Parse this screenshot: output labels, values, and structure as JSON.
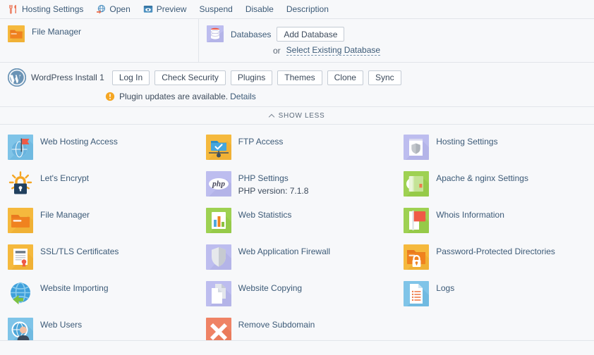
{
  "toolbar": {
    "items": [
      {
        "label": "Hosting Settings",
        "icon": "tools-icon"
      },
      {
        "label": "Open",
        "icon": "open-external-icon"
      },
      {
        "label": "Preview",
        "icon": "preview-window-icon"
      },
      {
        "label": "Suspend",
        "icon": "none"
      },
      {
        "label": "Disable",
        "icon": "none"
      },
      {
        "label": "Description",
        "icon": "none"
      }
    ]
  },
  "file_manager_row": {
    "file_manager": {
      "label": "File Manager",
      "icon": "folder-orange-icon"
    },
    "databases": {
      "label": "Databases",
      "icon": "database-icon",
      "add_button": "Add Database",
      "or_text": "or",
      "select_link": "Select Existing Database"
    }
  },
  "wordpress": {
    "icon": "wordpress-icon",
    "name": "WordPress Install 1",
    "buttons": [
      "Log In",
      "Check Security",
      "Plugins",
      "Themes",
      "Clone",
      "Sync"
    ],
    "warning_icon": "warning-icon",
    "warning_text": "Plugin updates are available.",
    "warning_link": "Details"
  },
  "show_less": {
    "label": "SHOW LESS",
    "icon": "chevron-up-icon"
  },
  "grid": {
    "items": [
      {
        "title": "Web Hosting Access",
        "sub": "",
        "icon": "web-hosting-access-icon"
      },
      {
        "title": "FTP Access",
        "sub": "",
        "icon": "ftp-access-icon"
      },
      {
        "title": "Hosting Settings",
        "sub": "",
        "icon": "hosting-settings-icon"
      },
      {
        "title": "Let's Encrypt",
        "sub": "",
        "icon": "lets-encrypt-icon"
      },
      {
        "title": "PHP Settings",
        "sub": "PHP version: 7.1.8",
        "icon": "php-settings-icon"
      },
      {
        "title": "Apache & nginx Settings",
        "sub": "",
        "icon": "apache-nginx-icon"
      },
      {
        "title": "File Manager",
        "sub": "",
        "icon": "file-manager-icon"
      },
      {
        "title": "Web Statistics",
        "sub": "",
        "icon": "web-statistics-icon"
      },
      {
        "title": "Whois Information",
        "sub": "",
        "icon": "whois-information-icon"
      },
      {
        "title": "SSL/TLS Certificates",
        "sub": "",
        "icon": "ssl-tls-icon"
      },
      {
        "title": "Web Application Firewall",
        "sub": "",
        "icon": "web-app-firewall-icon"
      },
      {
        "title": "Password-Protected Directories",
        "sub": "",
        "icon": "password-protected-icon"
      },
      {
        "title": "Website Importing",
        "sub": "",
        "icon": "website-importing-icon"
      },
      {
        "title": "Website Copying",
        "sub": "",
        "icon": "website-copying-icon"
      },
      {
        "title": "Logs",
        "sub": "",
        "icon": "logs-icon"
      },
      {
        "title": "Web Users",
        "sub": "",
        "icon": "web-users-icon"
      },
      {
        "title": "Remove Subdomain",
        "sub": "",
        "icon": "remove-subdomain-icon"
      }
    ]
  },
  "colors": {
    "background": "#f7f8fa",
    "border": "#e2e5ea",
    "link": "#3c5a77",
    "text": "#3c4a5b",
    "orange": "#f5a623",
    "blue_tile": "#7fc4e8",
    "lavender_tile": "#b8b8e8",
    "green_tile": "#9ed152",
    "salmon_tile": "#ef8365",
    "warning_yellow": "#f5a623"
  }
}
